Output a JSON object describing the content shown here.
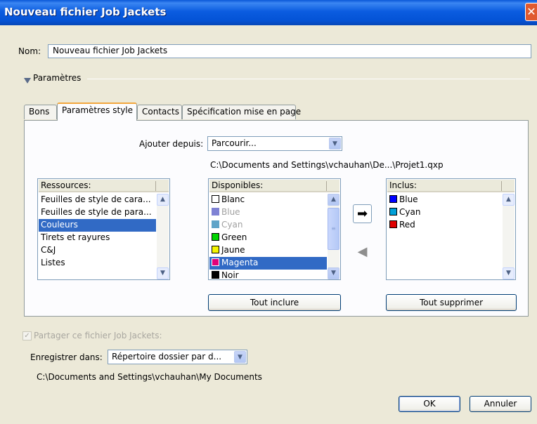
{
  "window": {
    "title": "Nouveau fichier Job Jackets",
    "close_glyph": "✕"
  },
  "name_field": {
    "label": "Nom:",
    "value": "Nouveau fichier Job Jackets"
  },
  "parameters_section": {
    "label": "Paramètres"
  },
  "tabs": [
    {
      "label": "Bons",
      "active": false
    },
    {
      "label": "Paramètres style",
      "active": true
    },
    {
      "label": "Contacts",
      "active": false
    },
    {
      "label": "Spécification mise en page",
      "active": false
    }
  ],
  "add_from": {
    "label": "Ajouter depuis:",
    "value": "Parcourir...",
    "path": "C:\\Documents and Settings\\vchauhan\\De...\\Projet1.qxp"
  },
  "resources_list": {
    "header": "Ressources:",
    "items": [
      "Feuilles de style de cara...",
      "Feuilles de style de para...",
      "Couleurs",
      "Tirets et rayures",
      "C&J",
      "Listes"
    ],
    "selected_index": 2
  },
  "available_list": {
    "header": "Disponibles:",
    "items": [
      {
        "label": "Blanc",
        "color": "#ffffff",
        "dimmed": false
      },
      {
        "label": "Blue",
        "color": "#7f82d4",
        "dimmed": true
      },
      {
        "label": "Cyan",
        "color": "#5fa4c8",
        "dimmed": true
      },
      {
        "label": "Green",
        "color": "#00d400",
        "dimmed": false
      },
      {
        "label": "Jaune",
        "color": "#f4f400",
        "dimmed": false
      },
      {
        "label": "Magenta",
        "color": "#e0007a",
        "dimmed": false
      },
      {
        "label": "Noir",
        "color": "#000000",
        "dimmed": false
      }
    ],
    "selected_index": 5
  },
  "included_list": {
    "header": "Inclus:",
    "items": [
      {
        "label": "Blue",
        "color": "#0000ff"
      },
      {
        "label": "Cyan",
        "color": "#00a0d8"
      },
      {
        "label": "Red",
        "color": "#e00000"
      }
    ]
  },
  "buttons": {
    "include_all": "Tout inclure",
    "remove_all": "Tout supprimer",
    "ok": "OK",
    "cancel": "Annuler"
  },
  "share": {
    "label": "Partager ce fichier Job Jackets:",
    "checked": true,
    "disabled": true
  },
  "save_in": {
    "label": "Enregistrer dans:",
    "value": "Répertoire dossier par d...",
    "path": "C:\\Documents and Settings\\vchauhan\\My Documents"
  },
  "icons": {
    "move_right": "arrow-right-icon",
    "move_left": "arrow-left-icon",
    "dropdown": "chevron-down-icon",
    "scroll_up": "chevron-up-icon",
    "scroll_down": "chevron-down-icon"
  }
}
